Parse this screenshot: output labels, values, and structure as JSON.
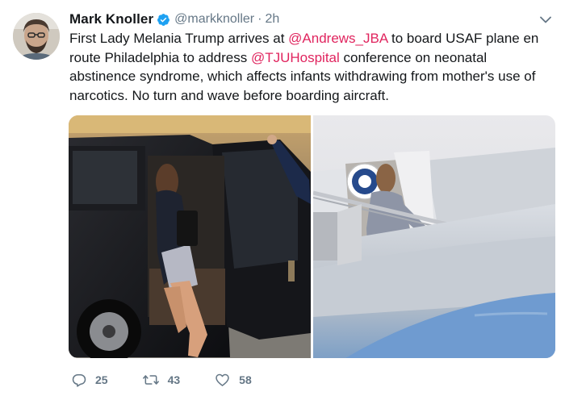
{
  "tweet": {
    "author": {
      "name": "Mark Knoller",
      "handle": "@markknoller",
      "separator": "·",
      "time": "2h",
      "avatar_icon": "person-avatar",
      "verified_icon": "verified-badge-icon"
    },
    "text": {
      "part1": "First Lady Melania Trump arrives at ",
      "mention1": "@Andrews_JBA",
      "part2": " to board USAF plane en route Philadelphia to address ",
      "mention2": "@TJUHospital",
      "part3": " conference on neonatal abstinence syndrome, which affects infants withdrawing from mother's use of narcotics. No turn and wave before boarding aircraft."
    },
    "media": {
      "photos": [
        "photo-suv-arrival",
        "photo-boarding-aircraft"
      ]
    },
    "actions": {
      "reply_count": "25",
      "retweet_count": "43",
      "like_count": "58"
    },
    "colors": {
      "mention": "#e0245e",
      "muted": "#657786",
      "verified": "#1da1f2"
    }
  }
}
